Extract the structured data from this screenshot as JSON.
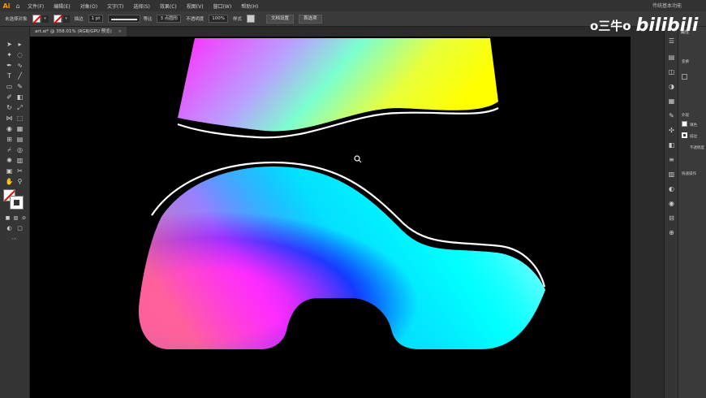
{
  "app": {
    "logo": "Ai",
    "menu": [
      "文件(F)",
      "编辑(E)",
      "对象(O)",
      "文字(T)",
      "选择(S)",
      "效果(C)",
      "视图(V)",
      "窗口(W)",
      "帮助(H)"
    ],
    "workspace": "传统基本功能"
  },
  "controlbar": {
    "selection_state": "未选择对象",
    "stroke_label": "描边",
    "stroke_weight": "1 pt",
    "profile_label": "等比",
    "brush_label": "3 点圆形",
    "opacity_label": "不透明度",
    "opacity_value": "100%",
    "style_label": "样式",
    "doc_setup_button": "文档设置",
    "preferences_button": "首选项"
  },
  "document": {
    "tab_title": "art.ai* @ 358.01% (RGB/GPU 预览)",
    "close": "×"
  },
  "watermark": {
    "text": "o三牛o",
    "logo": "bilibili"
  },
  "properties_panel": {
    "title": "属性",
    "items": [
      "变换",
      "外观",
      "填色",
      "描边",
      "不透明度",
      "快速操作"
    ]
  },
  "colors": {
    "canvas": "#000000",
    "ui_dark": "#323232",
    "ui_mid": "#3a3a3a",
    "logo": "#ff9a00"
  },
  "icons": {
    "home": "home-icon",
    "selection": "selection-tool-icon",
    "direct_selection": "direct-selection-tool-icon",
    "pen": "pen-tool-icon",
    "type": "type-tool-icon",
    "zoom": "zoom-tool-icon",
    "hand": "hand-tool-icon"
  }
}
